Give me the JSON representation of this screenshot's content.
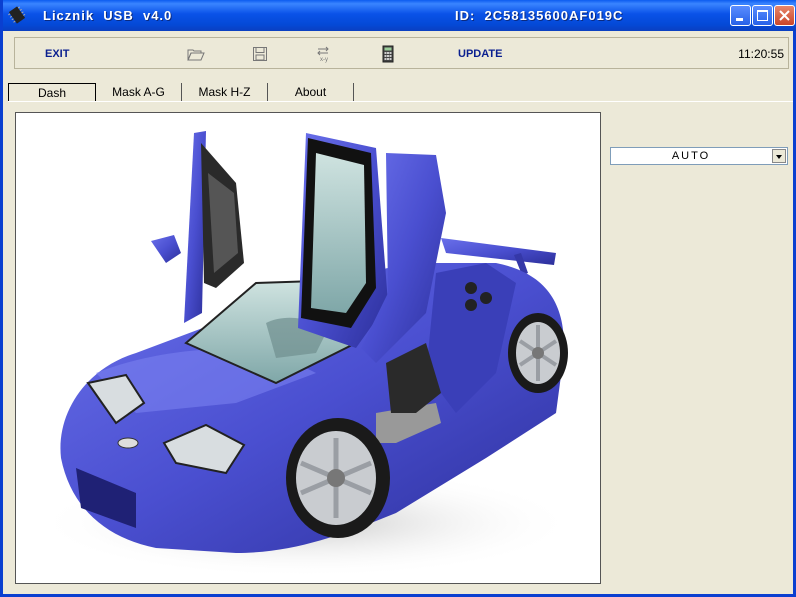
{
  "window": {
    "title": "Licznik  USB  v4.0",
    "device_id": "ID:  2C58135600AF019C",
    "title_color": "#0a52e8"
  },
  "toolbar": {
    "exit_label": "EXIT",
    "update_label": "UPDATE",
    "clock": "11:20:55",
    "icons": [
      "folder-open-icon",
      "save-icon",
      "swap-xy-icon",
      "calculator-icon"
    ]
  },
  "tabs": [
    {
      "label": "Dash",
      "active": true
    },
    {
      "label": "Mask A-G",
      "active": false
    },
    {
      "label": "Mask H-Z",
      "active": false
    },
    {
      "label": "About",
      "active": false
    }
  ],
  "mode_select": {
    "value": "AUTO"
  },
  "colors": {
    "accent": "#0a1f8f",
    "car": "#4a4fd0",
    "background": "#ece9d8"
  }
}
